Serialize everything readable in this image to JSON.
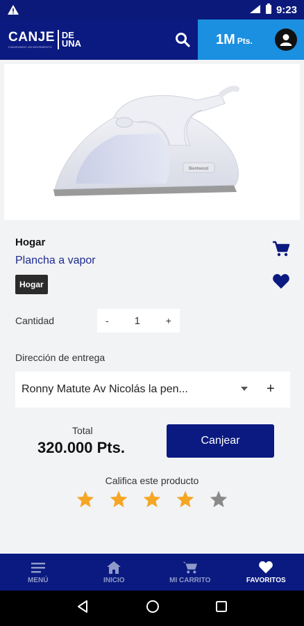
{
  "status_bar": {
    "time": "9:23",
    "network": "4G"
  },
  "header": {
    "logo_main": "CANJE",
    "logo_sub": "CANJEANDO UN MOVIMIENTO",
    "logo_de": "DE",
    "logo_una": "UNA",
    "points": "1M",
    "points_unit": "Pts."
  },
  "product": {
    "image_alt": "Plancha a vapor Bientwood",
    "brand_print": "Bientwood",
    "category": "Hogar",
    "name": "Plancha a vapor",
    "tag": "Hogar"
  },
  "quantity": {
    "label": "Cantidad",
    "minus": "-",
    "value": "1",
    "plus": "+"
  },
  "delivery": {
    "label": "Dirección de entrega",
    "selected": "Ronny Matute Av Nicolás la pen...",
    "add": "+"
  },
  "total": {
    "label": "Total",
    "value": "320.000 Pts."
  },
  "redeem_label": "Canjear",
  "rating": {
    "label": "Califica este producto",
    "value": 4,
    "max": 5,
    "filled_color": "#f5a623",
    "empty_color": "#8a8a8a"
  },
  "bottom_nav": [
    {
      "label": "MENÚ",
      "icon": "menu-icon"
    },
    {
      "label": "INICIO",
      "icon": "home-icon"
    },
    {
      "label": "MI CARRITO",
      "icon": "cart-icon"
    },
    {
      "label": "FAVORITOS",
      "icon": "heart-icon",
      "active": true
    }
  ],
  "colors": {
    "primary": "#0b1a80",
    "accent": "#1b8fe0"
  }
}
